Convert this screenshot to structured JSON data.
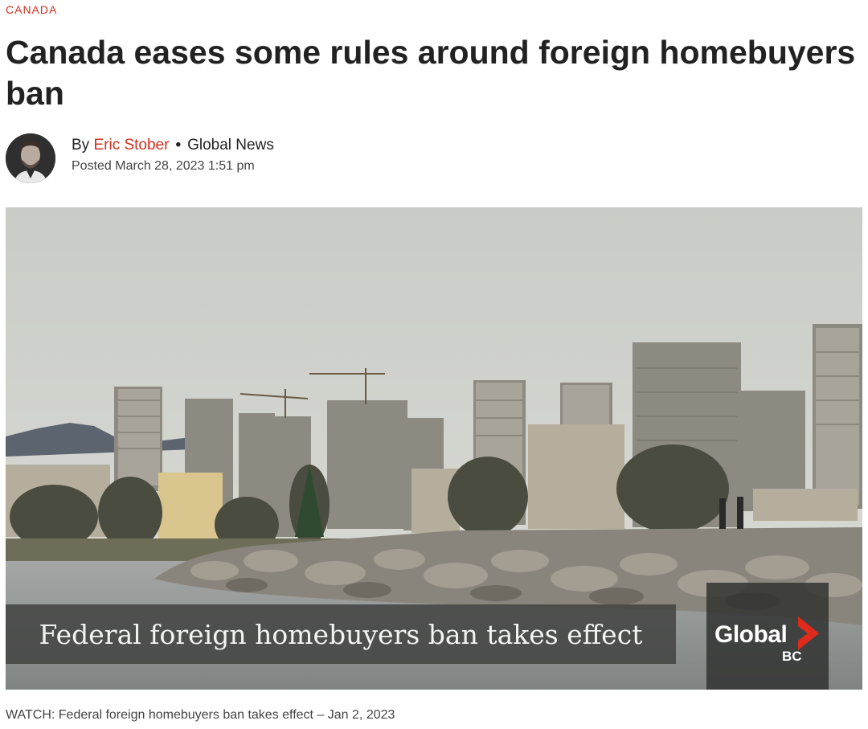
{
  "article": {
    "category": "CANADA",
    "headline": "Canada eases some rules around foreign homebuyers ban",
    "byline": {
      "prefix": "By",
      "author": "Eric Stober",
      "separator": "•",
      "source": "Global News",
      "posted": "Posted March 28, 2023 1:51 pm"
    }
  },
  "video": {
    "lower_third": "Federal foreign homebuyers ban takes effect",
    "bug": {
      "word": "Global",
      "region": "BC"
    },
    "caption": "WATCH: Federal foreign homebuyers ban takes effect – Jan 2, 2023"
  },
  "colors": {
    "accent": "#d2301f",
    "text": "#222222",
    "muted": "#444444"
  }
}
